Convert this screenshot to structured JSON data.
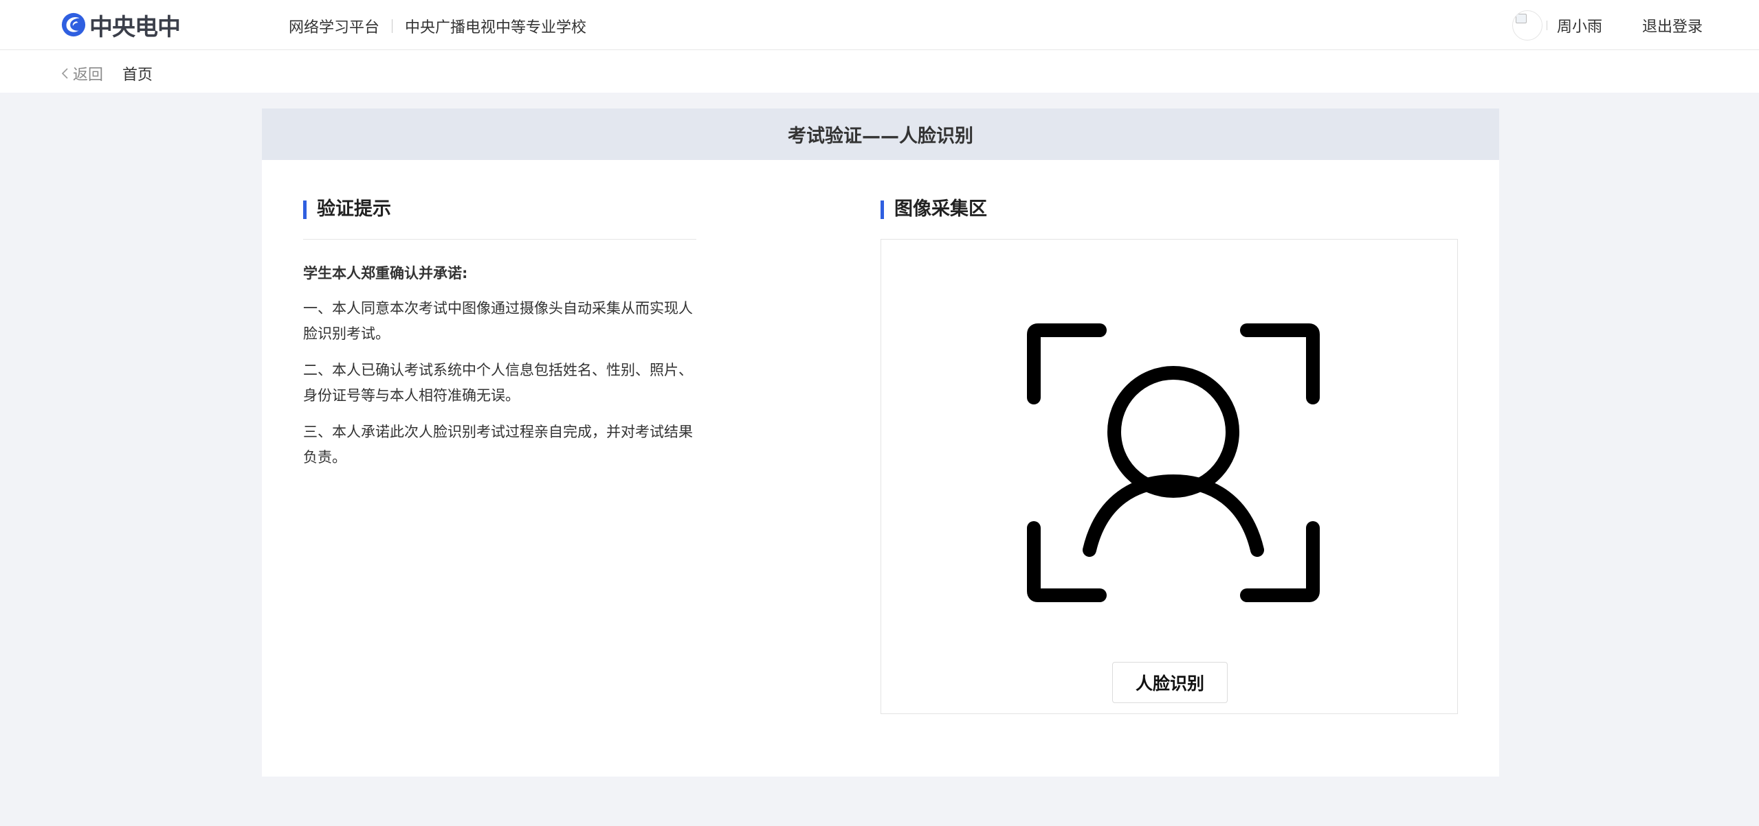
{
  "header": {
    "logo_text": "中央电中",
    "platform_name": "网络学习平台",
    "school_name": "中央广播电视中等专业学校",
    "user_name": "周小雨",
    "logout_label": "退出登录"
  },
  "subbar": {
    "back_label": "返回",
    "home_label": "首页"
  },
  "card": {
    "title": "考试验证——人脸识别"
  },
  "tips": {
    "title": "验证提示",
    "lead": "学生本人郑重确认并承诺:",
    "items": [
      "一、本人同意本次考试中图像通过摄像头自动采集从而实现人脸识别考试。",
      "二、本人已确认考试系统中个人信息包括姓名、性别、照片、身份证号等与本人相符准确无误。",
      "三、本人承诺此次人脸识别考试过程亲自完成，并对考试结果负责。"
    ]
  },
  "capture": {
    "title": "图像采集区",
    "button_label": "人脸识别",
    "icon": "face-scan-icon"
  },
  "colors": {
    "accent": "#2f5fe0",
    "card_header_bg": "#e3e7ef",
    "page_bg": "#f2f3f7"
  }
}
